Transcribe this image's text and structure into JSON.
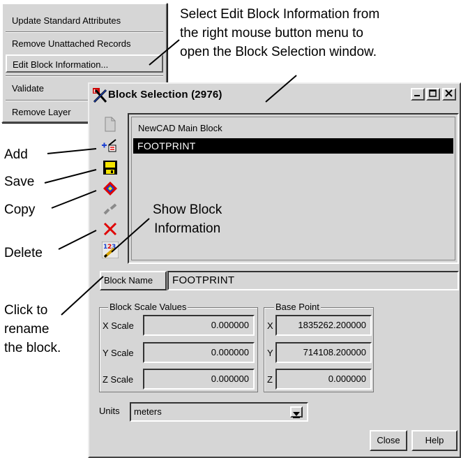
{
  "context_menu": {
    "items": [
      {
        "label": "Update Standard Attributes"
      },
      {
        "label": "Remove Unattached Records"
      },
      {
        "label": "Edit Block Information..."
      },
      {
        "label": "Validate"
      },
      {
        "label": "Remove Layer"
      }
    ]
  },
  "callouts": {
    "select_edit_line1": "Select Edit Block Information from",
    "select_edit_line2": "the right mouse button menu to",
    "select_edit_line3": "open the Block Selection window.",
    "add": "Add",
    "save": "Save",
    "copy": "Copy",
    "delete": "Delete",
    "show_info_line1": "Show Block",
    "show_info_line2": "Information",
    "rename_line1": "Click to",
    "rename_line2": "rename",
    "rename_line3": "the block."
  },
  "window": {
    "title": "Block Selection (2976)",
    "toolbar": {
      "icons": [
        "new-block-icon",
        "add-icon",
        "save-icon",
        "copy-icon",
        "link-icon",
        "delete-icon",
        "show-info-icon"
      ]
    },
    "list": {
      "header": "NewCAD  Main Block",
      "rows": [
        "FOOTPRINT"
      ]
    },
    "block_name_label": "Block Name",
    "block_name_value": "FOOTPRINT",
    "scale_group": {
      "title": "Block Scale Values",
      "x_label": "X Scale",
      "x_value": "0.000000",
      "y_label": "Y Scale",
      "y_value": "0.000000",
      "z_label": "Z Scale",
      "z_value": "0.000000"
    },
    "base_group": {
      "title": "Base Point",
      "x_label": "X",
      "x_value": "1835262.200000",
      "y_label": "Y",
      "y_value": "714108.200000",
      "z_label": "Z",
      "z_value": "0.000000"
    },
    "units_label": "Units",
    "units_value": "meters",
    "close_label": "Close",
    "help_label": "Help"
  }
}
